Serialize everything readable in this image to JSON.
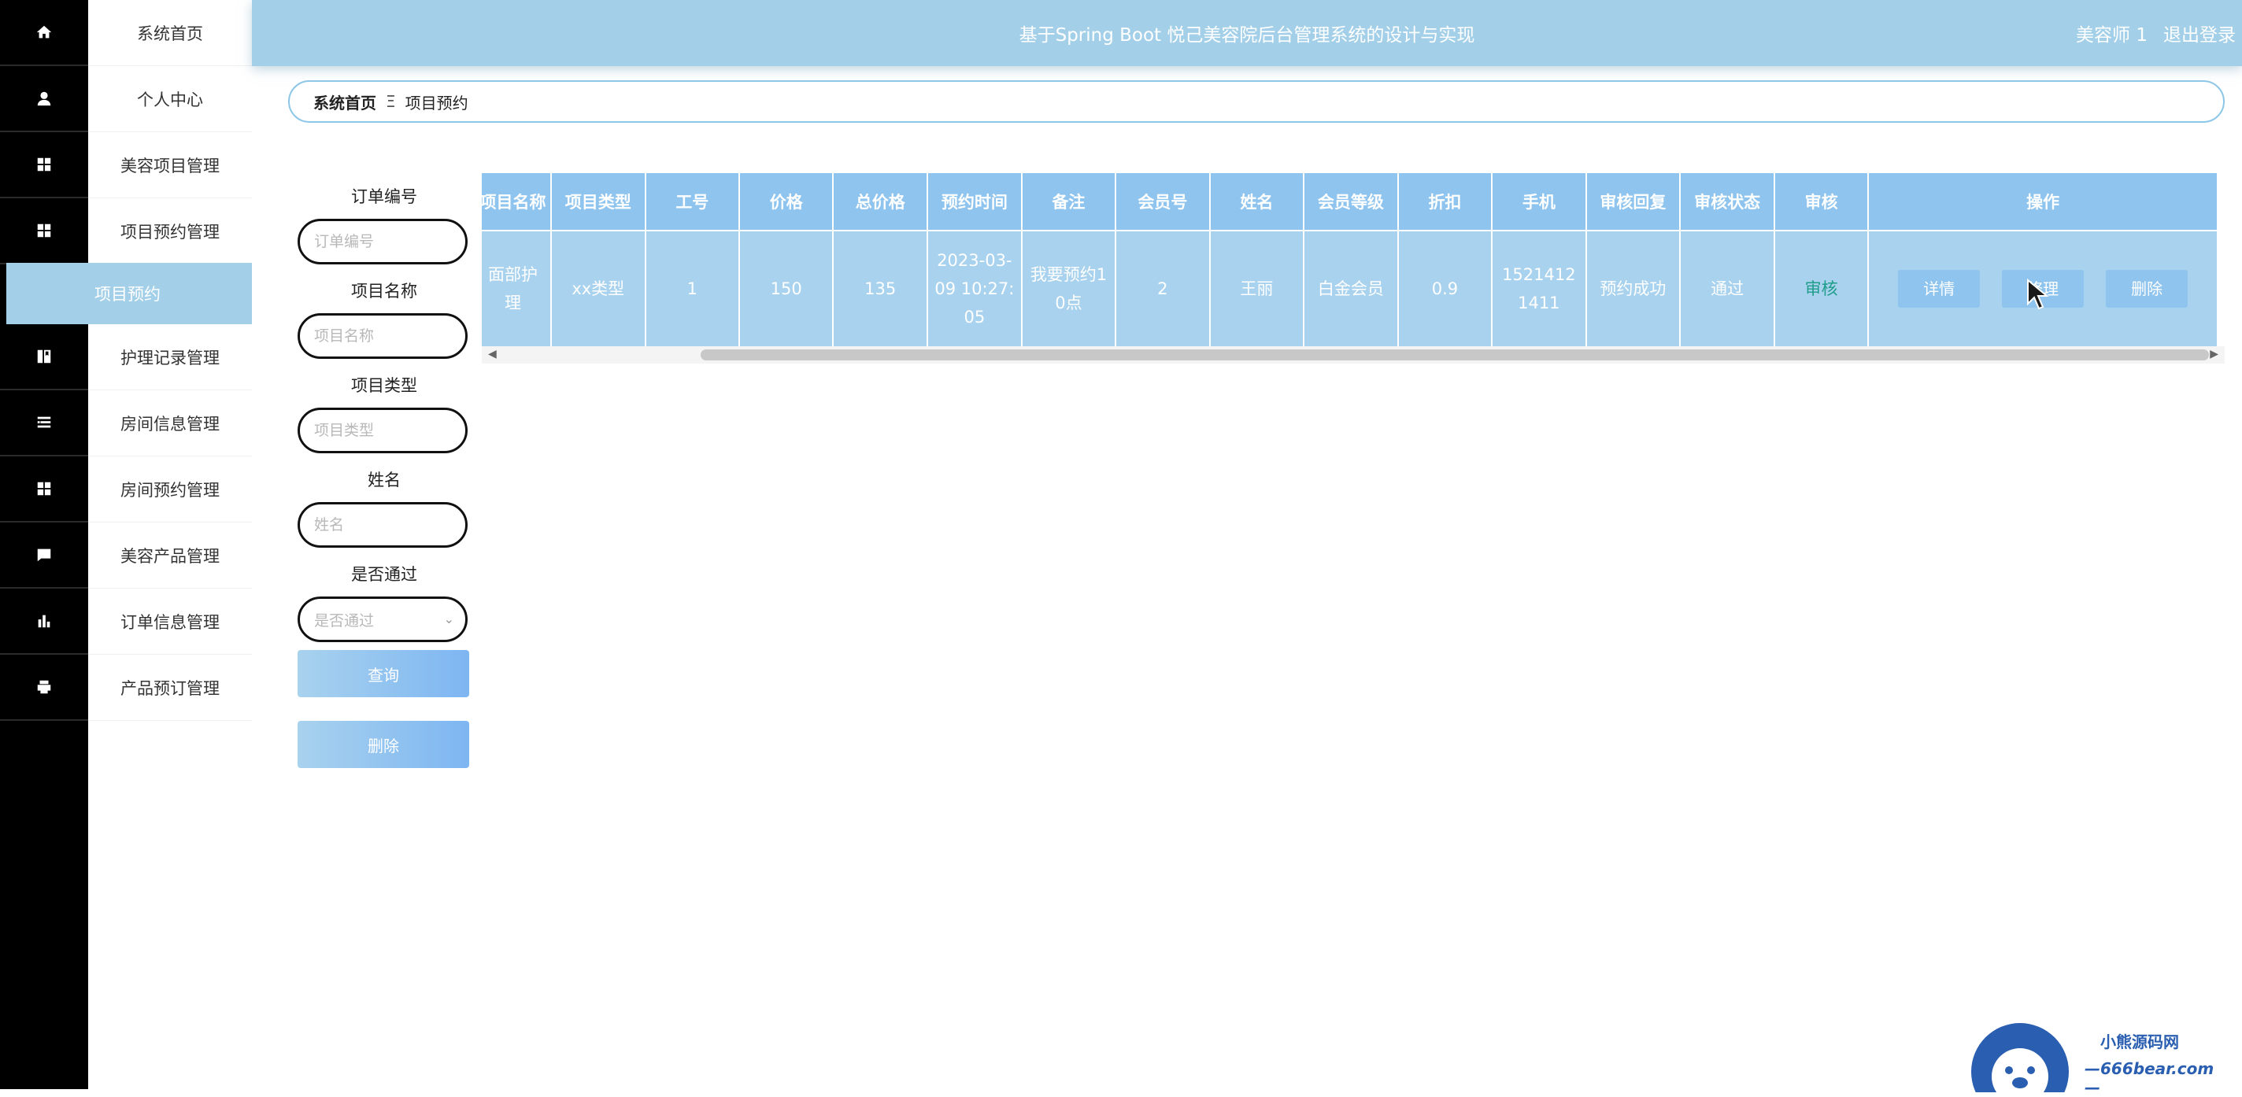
{
  "header": {
    "title": "基于Spring Boot 悦己美容院后台管理系统的设计与实现",
    "user": "美容师 1",
    "logout": "退出登录"
  },
  "sidebar": {
    "items": [
      {
        "label": "系统首页",
        "icon": "home-icon"
      },
      {
        "label": "个人中心",
        "icon": "user-icon"
      },
      {
        "label": "美容项目管理",
        "icon": "grid-icon"
      },
      {
        "label": "项目预约管理",
        "icon": "grid-icon"
      },
      {
        "label": "项目预约",
        "icon": "",
        "active": true
      },
      {
        "label": "护理记录管理",
        "icon": "book-icon"
      },
      {
        "label": "房间信息管理",
        "icon": "list-icon"
      },
      {
        "label": "房间预约管理",
        "icon": "grid-icon"
      },
      {
        "label": "美容产品管理",
        "icon": "chat-icon"
      },
      {
        "label": "订单信息管理",
        "icon": "bar-chart-icon"
      },
      {
        "label": "产品预订管理",
        "icon": "printer-icon"
      }
    ]
  },
  "breadcrumb": {
    "home": "系统首页",
    "separator": "Ξ",
    "current": "项目预约"
  },
  "search": {
    "order_no_label": "订单编号",
    "order_no_placeholder": "订单编号",
    "project_name_label": "项目名称",
    "project_name_placeholder": "项目名称",
    "project_type_label": "项目类型",
    "project_type_placeholder": "项目类型",
    "name_label": "姓名",
    "name_placeholder": "姓名",
    "passed_label": "是否通过",
    "passed_placeholder": "是否通过",
    "query_button": "查询",
    "delete_button": "删除"
  },
  "table": {
    "columns": [
      "项目名称",
      "项目类型",
      "工号",
      "价格",
      "总价格",
      "预约时间",
      "备注",
      "会员号",
      "姓名",
      "会员等级",
      "折扣",
      "手机",
      "审核回复",
      "审核状态",
      "审核",
      "操作"
    ],
    "rows": [
      {
        "project_name": "面部护理",
        "project_type": "xx类型",
        "staff_no": "1",
        "price": "150",
        "total_price": "135",
        "booking_time": "2023-03-09 10:27:05",
        "remark": "我要预约10点",
        "member_no": "2",
        "name": "王丽",
        "member_level": "白金会员",
        "discount": "0.9",
        "phone": "15214121411",
        "audit_reply": "预约成功",
        "audit_status": "通过",
        "audit": "审核",
        "actions": {
          "detail": "详情",
          "edit": "修理",
          "delete": "删除"
        }
      }
    ]
  },
  "watermark": {
    "line1": "小熊源码网",
    "line2": "—666bear.com—"
  },
  "colors": {
    "header": "#a3d0e8",
    "sidebar_dark": "#000000",
    "table_header": "#8ec4ee",
    "table_row": "#a8d2ee",
    "button_gradient_start": "#a8d2ee",
    "button_gradient_end": "#7eb6f2",
    "audit_link": "#1f9d8a"
  }
}
